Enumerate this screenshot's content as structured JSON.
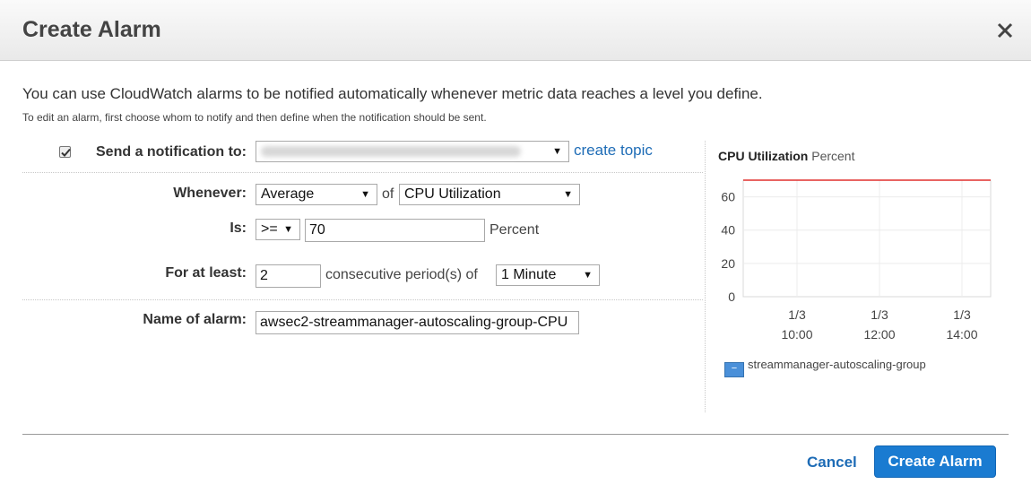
{
  "dialog": {
    "title": "Create Alarm",
    "intro": "You can use CloudWatch alarms to be notified automatically whenever metric data reaches a level you define.",
    "intro_sub": "To edit an alarm, first choose whom to notify and then define when the notification should be sent."
  },
  "form": {
    "notify_label": "Send a notification to:",
    "notify_checked": true,
    "create_topic": "create topic",
    "whenever_label": "Whenever:",
    "statistic": "Average",
    "of1": "of",
    "metric": "CPU Utilization",
    "is_label": "Is:",
    "operator": ">=",
    "threshold": "70",
    "unit": "Percent",
    "for_label": "For at least:",
    "periods": "2",
    "periods_text": "consecutive period(s) of",
    "period_length": "1 Minute",
    "name_label": "Name of alarm:",
    "alarm_name": "awsec2-streammanager-autoscaling-group-CPU"
  },
  "buttons": {
    "cancel": "Cancel",
    "create": "Create Alarm"
  },
  "chart_data": {
    "type": "line",
    "title": "CPU Utilization",
    "unit_label": "Percent",
    "ylim": [
      0,
      70
    ],
    "y_ticks": [
      0,
      20,
      40,
      60
    ],
    "x_tick_labels": [
      [
        "1/3",
        "10:00"
      ],
      [
        "1/3",
        "12:00"
      ],
      [
        "1/3",
        "14:00"
      ]
    ],
    "threshold": 70,
    "threshold_color": "#e0302e",
    "series": [
      {
        "name": "streammanager-autoscaling-group",
        "values": []
      }
    ],
    "grid": true
  }
}
